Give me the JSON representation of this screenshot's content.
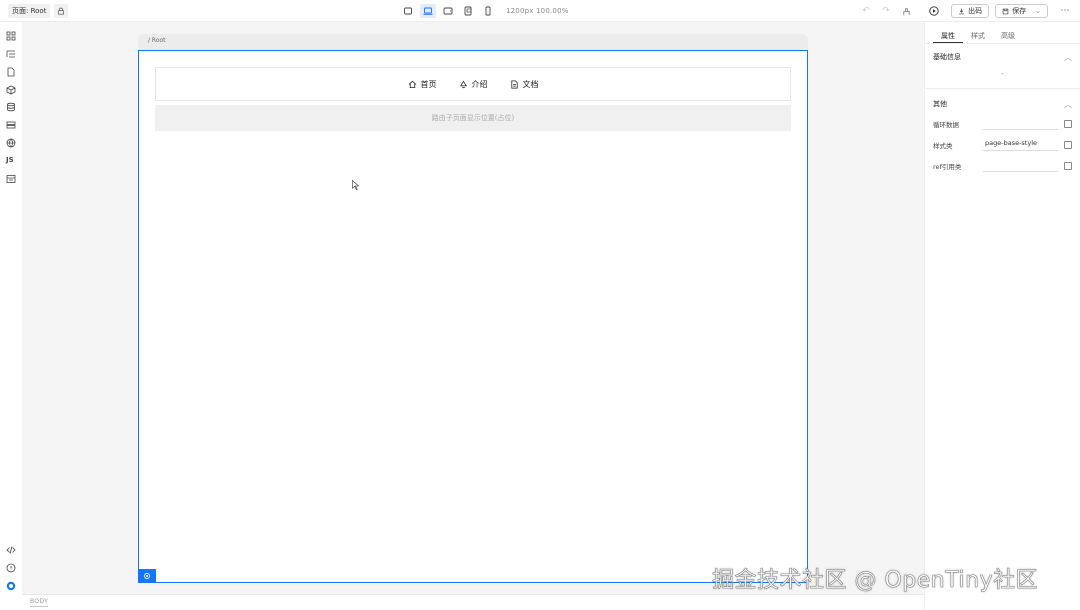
{
  "topbar": {
    "page_label": "页面: Root",
    "canvas_size": "1200px  100.00%",
    "download_label": "出码",
    "save_label": "保存"
  },
  "canvas": {
    "path": "/ Root",
    "nav_items": [
      {
        "label": "首页",
        "icon": "home-icon"
      },
      {
        "label": "介绍",
        "icon": "recycle-icon"
      },
      {
        "label": "文档",
        "icon": "document-icon"
      }
    ],
    "slot_text": "路由子页面显示位置(占位)"
  },
  "bottombar": {
    "body_tag": "BODY"
  },
  "rightpanel": {
    "tabs": [
      "属性",
      "样式",
      "高级"
    ],
    "basic_section": "基础信息",
    "basic_empty": "-",
    "other_section": "其他",
    "props": [
      {
        "label": "循环数据",
        "value": ""
      },
      {
        "label": "样式类",
        "value": "page-base-style"
      },
      {
        "label": "ref引用类",
        "value": ""
      }
    ]
  },
  "watermark": "掘金技术社区 @ OpenTiny社区",
  "colors": {
    "accent": "#1476ff",
    "workarea": "#f5f5f5"
  }
}
